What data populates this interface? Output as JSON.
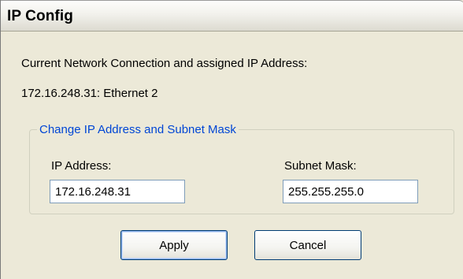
{
  "window": {
    "title": "IP Config"
  },
  "connection": {
    "heading": "Current Network Connection and assigned IP Address:",
    "current": "172.16.248.31: Ethernet 2"
  },
  "group": {
    "legend": "Change IP Address and Subnet Mask",
    "ip_label": "IP Address:",
    "ip_value": "172.16.248.31",
    "subnet_label": "Subnet Mask:",
    "subnet_value": "255.255.255.0"
  },
  "buttons": {
    "apply": "Apply",
    "cancel": "Cancel"
  },
  "colors": {
    "window_bg": "#ece9d8",
    "legend_text": "#0046d5",
    "textbox_border": "#7f9db9",
    "button_border": "#003c74"
  }
}
